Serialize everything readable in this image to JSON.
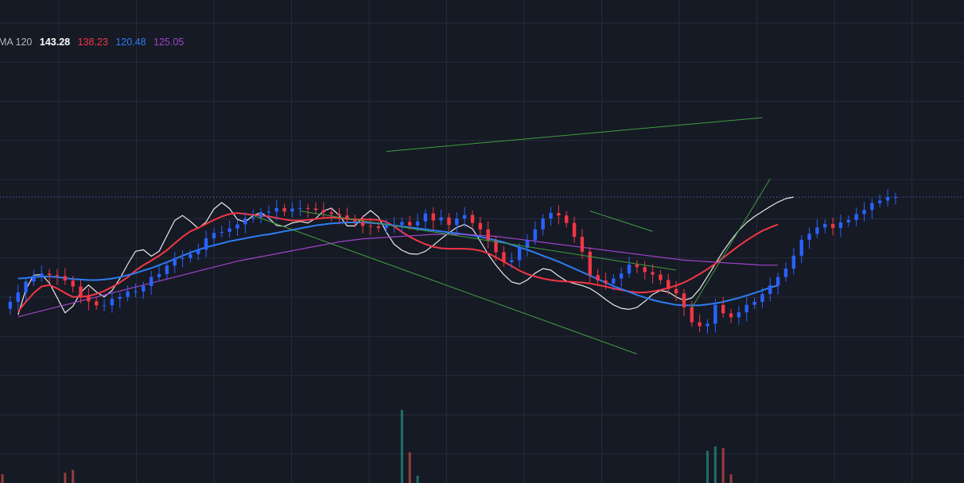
{
  "legend": {
    "label": "MA 120",
    "values": [
      "143.28",
      "138.23",
      "120.48",
      "125.05"
    ]
  },
  "colors": {
    "background": "#161a25",
    "grid": "#262b38",
    "candle_up": "#2962ff",
    "candle_down": "#f23645",
    "volume_up": "#26a69a",
    "volume_down": "#ef5350",
    "price_line": "#5b7ce6",
    "trendline": "#3f9d3f",
    "ma_short": "#e8e8e8",
    "ma_mid": "#f23645",
    "ma_long": "#2e7df0",
    "ma_longest": "#a043c8",
    "legend_label": "#b2b5be"
  },
  "chart_data": {
    "type": "candlestick",
    "note_units": "price",
    "ylim": [
      87,
      183
    ],
    "grid": true,
    "last_price": 143.3,
    "closes": [
      120.8,
      122.2,
      124.1,
      126.3,
      127.4,
      127.9,
      127.6,
      127.4,
      126.5,
      125.3,
      123.4,
      122.3,
      121.5,
      121.5,
      122.8,
      123.2,
      124.3,
      124.3,
      125.4,
      127.2,
      127.8,
      129.5,
      131.0,
      131.0,
      131.8,
      132.7,
      135.0,
      136.1,
      136.3,
      137.0,
      137.8,
      139.0,
      139.2,
      140.2,
      140.4,
      141.1,
      140.4,
      141.0,
      141.1,
      141.0,
      140.7,
      140.2,
      139.9,
      139.6,
      138.9,
      138.4,
      137.5,
      137.4,
      137.1,
      137.6,
      137.7,
      138.3,
      137.6,
      138.4,
      140.0,
      138.6,
      139.2,
      137.7,
      139.0,
      139.7,
      138.1,
      136.8,
      134.5,
      132.2,
      130.2,
      130.6,
      133.1,
      134.6,
      136.8,
      139.0,
      140.1,
      139.6,
      138.1,
      135.3,
      132.3,
      127.6,
      126.5,
      125.9,
      126.9,
      127.9,
      129.7,
      129.2,
      128.2,
      127.7,
      126.6,
      124.8,
      123.9,
      121.1,
      118.1,
      117.3,
      117.8,
      121.6,
      119.9,
      119.1,
      120.1,
      121.6,
      122.2,
      123.8,
      125.5,
      127.2,
      128.9,
      131.5,
      134.7,
      135.9,
      137.2,
      137.9,
      137.1,
      138.2,
      138.7,
      139.9,
      140.7,
      142.1,
      142.6,
      143.3,
      143.3
    ],
    "volume_bars": [
      {
        "index": 0,
        "value": 12
      },
      {
        "index": 8,
        "value": 14
      },
      {
        "index": 9,
        "value": 18
      },
      {
        "index": 51,
        "value": 100
      },
      {
        "index": 52,
        "value": 42
      },
      {
        "index": 53,
        "value": 10
      },
      {
        "index": 90,
        "value": 44
      },
      {
        "index": 91,
        "value": 50
      },
      {
        "index": 92,
        "value": 48
      },
      {
        "index": 93,
        "value": 12
      }
    ],
    "series": [
      {
        "values": [
          119.6,
          124.7,
          127.6,
          127.7,
          126.0,
          123.0,
          120.0,
          121.3,
          124.1,
          125.6,
          124.2,
          123.2,
          124.5,
          126.9,
          129.8,
          132.4,
          132.7,
          131.4,
          132.4,
          135.5,
          138.6,
          139.6,
          138.4,
          137.0,
          138.3,
          140.9,
          142.2,
          141.0,
          138.8,
          138.3,
          139.6,
          140.2,
          139.1,
          137.6,
          137.4,
          138.1,
          138.4,
          138.1,
          139.0,
          140.5,
          141.1,
          139.6,
          137.5,
          137.5,
          139.3,
          140.6,
          139.3,
          136.3,
          133.8,
          132.6,
          131.9,
          131.8,
          132.4,
          133.6,
          134.9,
          136.1,
          137.2,
          137.8,
          136.9,
          134.4,
          131.8,
          129.6,
          127.7,
          126.2,
          125.8,
          126.6,
          128.0,
          128.9,
          128.6,
          127.4,
          126.4,
          125.9,
          125.5,
          124.9,
          123.9,
          122.7,
          121.6,
          120.9,
          120.7,
          121.1,
          122.3,
          123.7,
          124.5,
          124.2,
          123.2,
          122.5,
          123.0,
          124.8,
          127.3,
          129.9,
          132.4,
          134.6,
          136.6,
          138.2,
          139.4,
          140.4,
          141.4,
          142.3,
          143.0,
          143.3
        ]
      },
      {
        "values": [
          120.3,
          122.2,
          124.0,
          125.3,
          125.6,
          124.9,
          124.0,
          123.2,
          123.2,
          123.4,
          123.8,
          124.4,
          125.2,
          126.1,
          127.2,
          128.5,
          129.6,
          130.5,
          131.5,
          132.6,
          134.0,
          135.3,
          136.4,
          137.1,
          137.9,
          138.7,
          139.4,
          139.9,
          140.1,
          139.9,
          139.7,
          139.6,
          139.4,
          139.1,
          138.8,
          138.6,
          138.6,
          138.7,
          138.9,
          139.1,
          139.2,
          139.1,
          138.9,
          138.8,
          138.8,
          138.8,
          138.7,
          138.3,
          137.4,
          136.3,
          135.3,
          134.5,
          133.8,
          133.3,
          133.0,
          132.9,
          132.9,
          132.9,
          132.8,
          132.5,
          132.0,
          131.2,
          130.3,
          129.4,
          128.5,
          127.8,
          127.3,
          126.9,
          126.6,
          126.4,
          126.3,
          126.2,
          126.1,
          125.9,
          125.6,
          125.3,
          124.9,
          124.6,
          124.3,
          124.1,
          124.1,
          124.3,
          124.6,
          125.0,
          125.5,
          126.1,
          126.9,
          127.8,
          128.8,
          129.9,
          131.1,
          132.3,
          133.5,
          134.6,
          135.6,
          136.5,
          137.2,
          137.8
        ]
      },
      {
        "values": [
          126.9,
          127.0,
          127.2,
          127.3,
          127.3,
          127.2,
          127.0,
          126.8,
          126.7,
          126.6,
          126.6,
          126.7,
          126.9,
          127.2,
          127.6,
          128.0,
          128.5,
          129.0,
          129.6,
          130.2,
          130.8,
          131.5,
          132.1,
          132.7,
          133.2,
          133.6,
          134.0,
          134.4,
          134.7,
          135.0,
          135.3,
          135.6,
          135.8,
          136.1,
          136.4,
          136.7,
          137.0,
          137.3,
          137.6,
          137.8,
          138.0,
          138.1,
          138.2,
          138.2,
          138.2,
          138.1,
          138.0,
          137.8,
          137.6,
          137.4,
          137.2,
          137.0,
          136.8,
          136.6,
          136.4,
          136.2,
          136.0,
          135.8,
          135.6,
          135.3,
          135.0,
          134.6,
          134.2,
          133.7,
          133.2,
          132.7,
          132.1,
          131.5,
          130.9,
          130.3,
          129.6,
          128.9,
          128.2,
          127.5,
          126.8,
          126.1,
          125.4,
          124.8,
          124.2,
          123.6,
          123.1,
          122.6,
          122.2,
          121.9,
          121.6,
          121.5,
          121.5,
          121.5,
          121.7,
          121.9,
          122.2,
          122.6,
          123.0,
          123.5,
          124.0,
          124.5,
          125.1,
          125.5
        ]
      },
      {
        "values": [
          119.2,
          119.6,
          120.0,
          120.4,
          120.8,
          121.2,
          121.6,
          122.0,
          122.4,
          122.8,
          123.2,
          123.6,
          124.0,
          124.4,
          124.8,
          125.2,
          125.6,
          126.0,
          126.4,
          126.8,
          127.2,
          127.6,
          128.0,
          128.4,
          128.8,
          129.2,
          129.6,
          130.0,
          130.4,
          130.7,
          131.0,
          131.3,
          131.6,
          131.9,
          132.2,
          132.5,
          132.8,
          133.1,
          133.4,
          133.7,
          134.0,
          134.3,
          134.5,
          134.7,
          134.9,
          135.0,
          135.1,
          135.2,
          135.3,
          135.4,
          135.5,
          135.6,
          135.7,
          135.8,
          135.8,
          135.8,
          135.8,
          135.8,
          135.7,
          135.6,
          135.5,
          135.4,
          135.2,
          135.0,
          134.8,
          134.6,
          134.4,
          134.2,
          134.0,
          133.8,
          133.6,
          133.4,
          133.2,
          133.0,
          132.8,
          132.6,
          132.4,
          132.2,
          132.0,
          131.8,
          131.6,
          131.4,
          131.2,
          131.0,
          130.8,
          130.6,
          130.5,
          130.4,
          130.3,
          130.2,
          130.1,
          130.0,
          129.9,
          129.8,
          129.7,
          129.6,
          129.6,
          129.6
        ]
      }
    ],
    "trendlines": [
      {
        "from": {
          "bar": 49,
          "price": 152.5
        },
        "to": {
          "bar": 97,
          "price": 159.3
        }
      },
      {
        "from": {
          "bar": 38,
          "price": 140.5
        },
        "to": {
          "bar": 86,
          "price": 128.6
        }
      },
      {
        "from": {
          "bar": 75,
          "price": 140.5
        },
        "to": {
          "bar": 83,
          "price": 136.4
        }
      },
      {
        "from": {
          "bar": 32,
          "price": 139.6
        },
        "to": {
          "bar": 81,
          "price": 111.7
        }
      },
      {
        "from": {
          "bar": 88,
          "price": 121.0
        },
        "to": {
          "bar": 98,
          "price": 147.0
        }
      }
    ]
  }
}
